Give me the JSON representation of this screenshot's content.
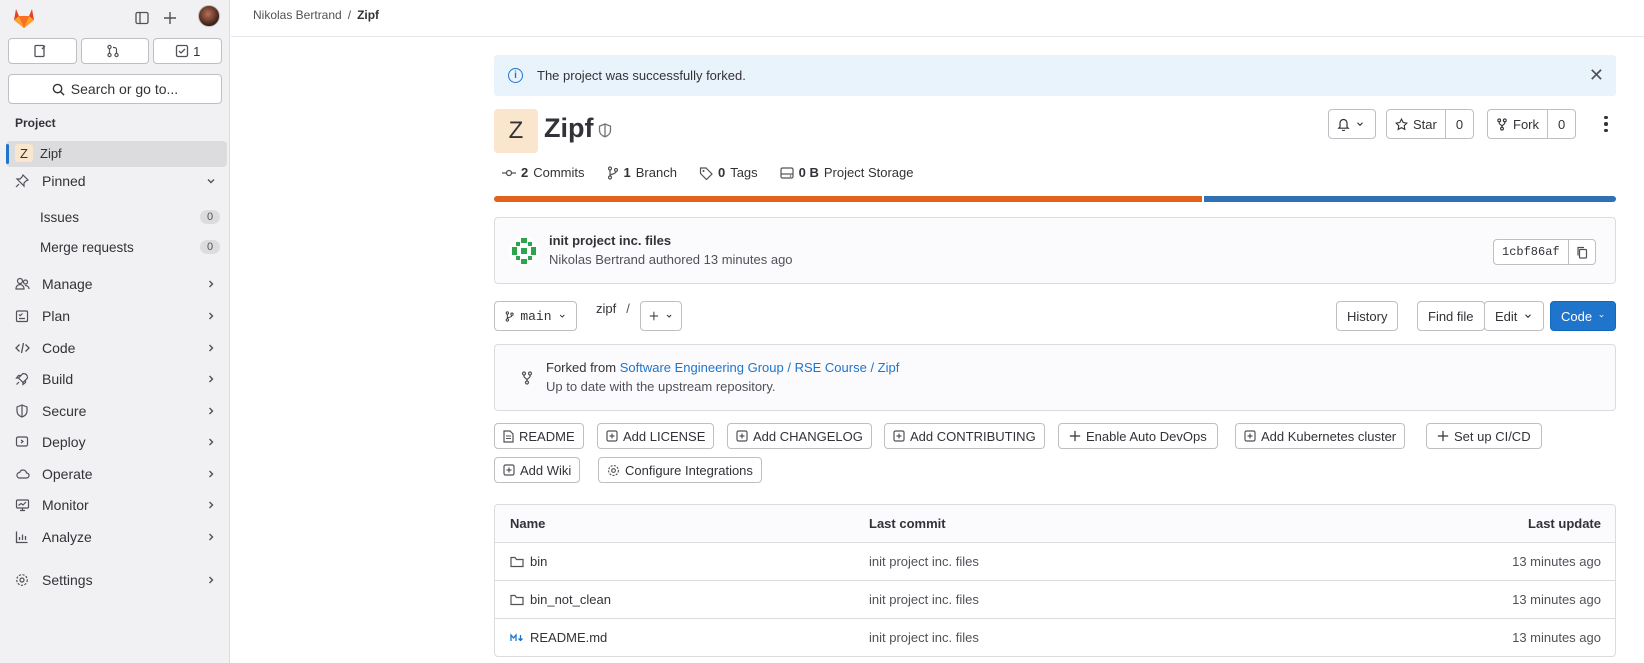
{
  "sidebar": {
    "counts": [
      {
        "icon": "issues-icon",
        "value": ""
      },
      {
        "icon": "merge-request-icon",
        "value": ""
      },
      {
        "icon": "todo-icon",
        "value": "1"
      }
    ],
    "search_label": "Search or go to...",
    "section_title": "Project",
    "project_item": {
      "avatar_letter": "Z",
      "label": "Zipf"
    },
    "pinned_label": "Pinned",
    "pinned_items": [
      {
        "label": "Issues",
        "count": "0"
      },
      {
        "label": "Merge requests",
        "count": "0"
      }
    ],
    "nav": [
      {
        "label": "Manage",
        "icon": "users-icon"
      },
      {
        "label": "Plan",
        "icon": "plan-icon"
      },
      {
        "label": "Code",
        "icon": "code-icon"
      },
      {
        "label": "Build",
        "icon": "rocket-icon"
      },
      {
        "label": "Secure",
        "icon": "shield-icon"
      },
      {
        "label": "Deploy",
        "icon": "deploy-icon"
      },
      {
        "label": "Operate",
        "icon": "cloud-icon"
      },
      {
        "label": "Monitor",
        "icon": "monitor-icon"
      },
      {
        "label": "Analyze",
        "icon": "chart-icon"
      },
      {
        "label": "Settings",
        "icon": "gear-icon"
      }
    ]
  },
  "breadcrumb": {
    "owner": "Nikolas Bertrand",
    "separator": "/",
    "project": "Zipf"
  },
  "alert": {
    "text": "The project was successfully forked."
  },
  "project": {
    "avatar_letter": "Z",
    "title": "Zipf",
    "star_label": "Star",
    "star_count": "0",
    "fork_label": "Fork",
    "fork_count": "0",
    "stats": [
      {
        "icon": "commit-icon",
        "value": "2",
        "label": "Commits"
      },
      {
        "icon": "branch-icon",
        "value": "1",
        "label": "Branch"
      },
      {
        "icon": "tag-icon",
        "value": "0",
        "label": "Tags"
      },
      {
        "icon": "storage-icon",
        "value": "0 B",
        "label": "Project Storage"
      }
    ],
    "languages": [
      {
        "color": "#e0621d",
        "fraction": 0.632
      },
      {
        "color": "#3071b5",
        "fraction": 0.368
      }
    ]
  },
  "commit": {
    "message": "init project inc. files",
    "meta": "Nikolas Bertrand authored 13 minutes ago",
    "sha": "1cbf86af"
  },
  "toolbar": {
    "branch": "main",
    "path": "zipf",
    "path_sep": "/",
    "history": "History",
    "find_file": "Find file",
    "edit": "Edit",
    "code": "Code"
  },
  "fork_info": {
    "prefix": "Forked from",
    "link": "Software Engineering Group / RSE Course / Zipf",
    "status": "Up to date with the upstream repository."
  },
  "quick_actions": [
    {
      "label": "README",
      "icon": "file-icon"
    },
    {
      "label": "Add LICENSE",
      "icon": "plus-square-icon"
    },
    {
      "label": "Add CHANGELOG",
      "icon": "plus-square-icon"
    },
    {
      "label": "Add CONTRIBUTING",
      "icon": "plus-square-icon"
    },
    {
      "label": "Enable Auto DevOps",
      "icon": "plus-icon"
    },
    {
      "label": "Add Kubernetes cluster",
      "icon": "plus-square-icon"
    },
    {
      "label": "Set up CI/CD",
      "icon": "plus-icon"
    },
    {
      "label": "Add Wiki",
      "icon": "plus-square-icon"
    },
    {
      "label": "Configure Integrations",
      "icon": "gear-icon"
    }
  ],
  "files": {
    "headers": [
      "Name",
      "Last commit",
      "Last update"
    ],
    "rows": [
      {
        "name": "bin",
        "type": "folder",
        "commit": "init project inc. files",
        "updated": "13 minutes ago"
      },
      {
        "name": "bin_not_clean",
        "type": "folder",
        "commit": "init project inc. files",
        "updated": "13 minutes ago"
      },
      {
        "name": "README.md",
        "type": "markdown",
        "commit": "init project inc. files",
        "updated": "13 minutes ago"
      }
    ]
  }
}
